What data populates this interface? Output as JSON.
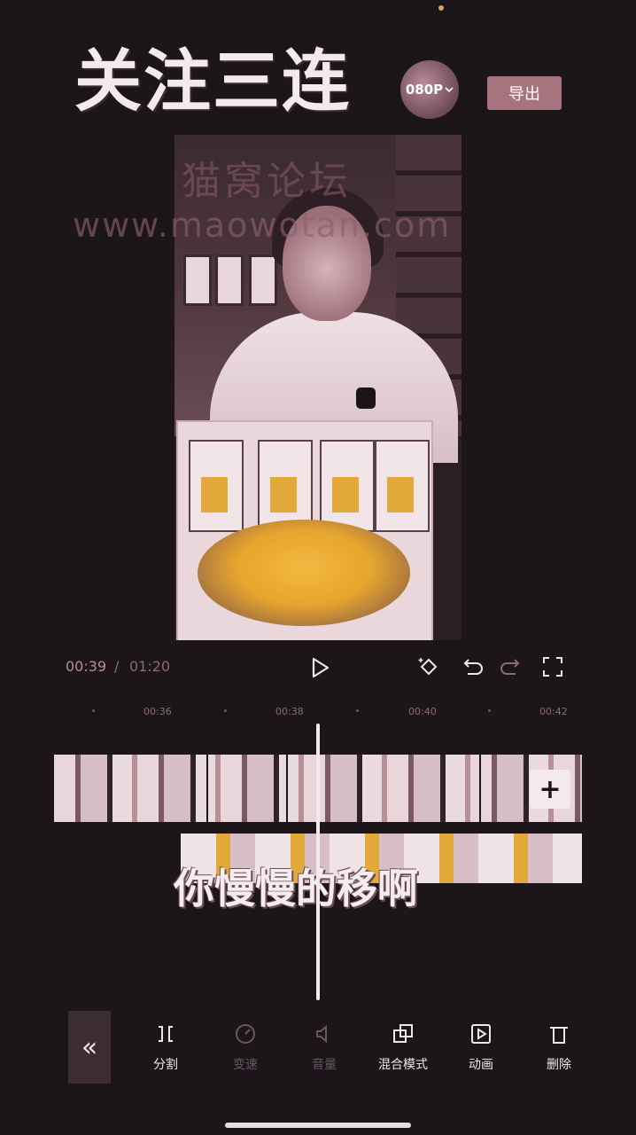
{
  "header": {
    "title": "关注三连",
    "resolution": "080P",
    "export_label": "导出"
  },
  "watermark": {
    "site_name": "猫窝论坛",
    "url": "www.maowotan.com"
  },
  "playback": {
    "current_time": "00:39",
    "separator": "/",
    "total_time": "01:20"
  },
  "timeline": {
    "ruler_labels": [
      "00:36",
      "00:38",
      "00:40",
      "00:42"
    ],
    "subtitle": "你慢慢的移啊"
  },
  "toolbar": {
    "items": [
      {
        "label": "分割",
        "icon": "split-icon"
      },
      {
        "label": "变速",
        "icon": "speed-icon"
      },
      {
        "label": "音量",
        "icon": "volume-icon"
      },
      {
        "label": "混合模式",
        "icon": "blend-mode-icon"
      },
      {
        "label": "动画",
        "icon": "animation-icon"
      },
      {
        "label": "删除",
        "icon": "delete-icon"
      }
    ]
  },
  "colors": {
    "background": "#1c161b",
    "accent": "#a7737f"
  }
}
